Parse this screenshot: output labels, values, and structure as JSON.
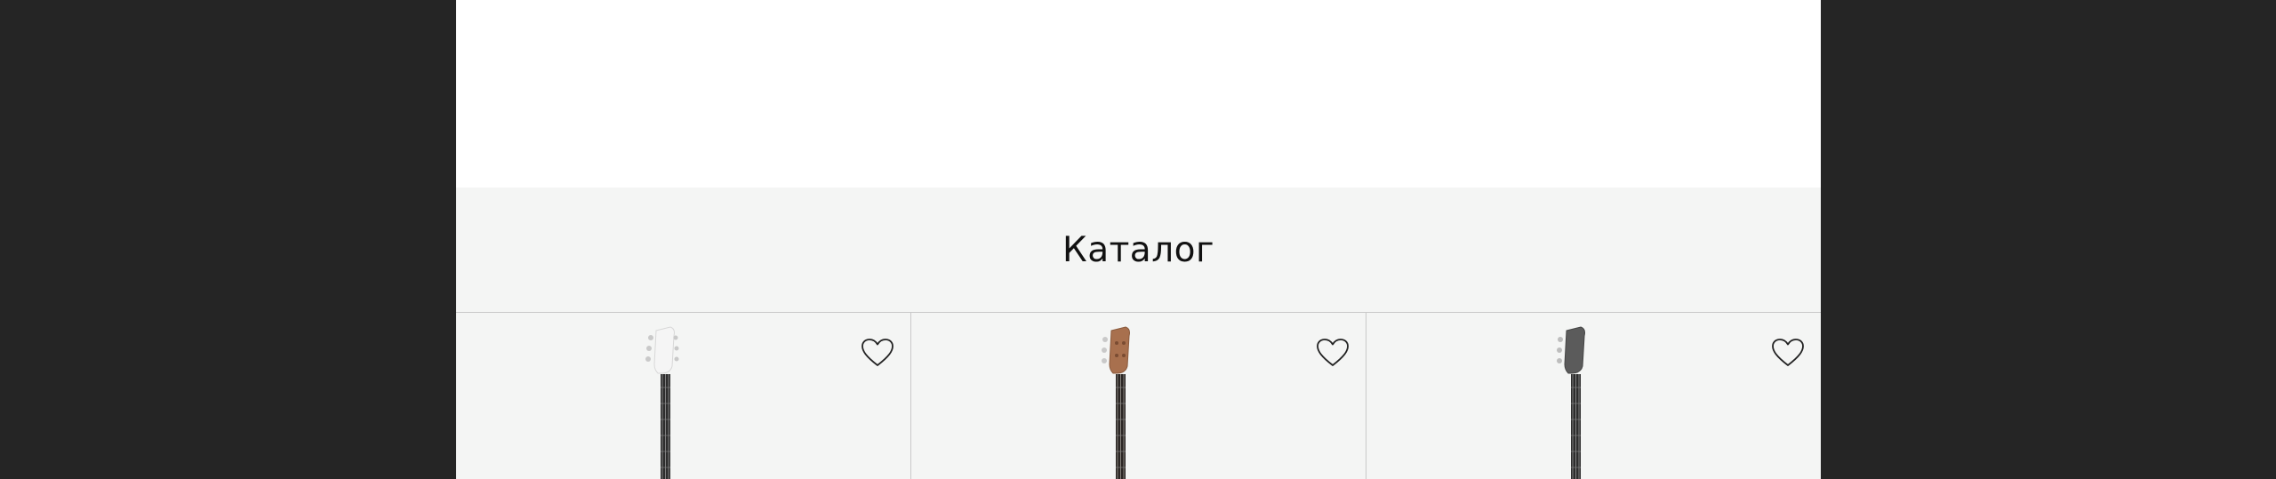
{
  "catalog": {
    "title": "Каталог"
  },
  "products": [
    {
      "color": "#f4f4f4",
      "accent": "#dcdcdc"
    },
    {
      "color": "#a9714f",
      "accent": "#8a5a3d"
    },
    {
      "color": "#5a5a5a",
      "accent": "#454545"
    }
  ],
  "icons": {
    "favorite": "heart-outline-icon"
  }
}
